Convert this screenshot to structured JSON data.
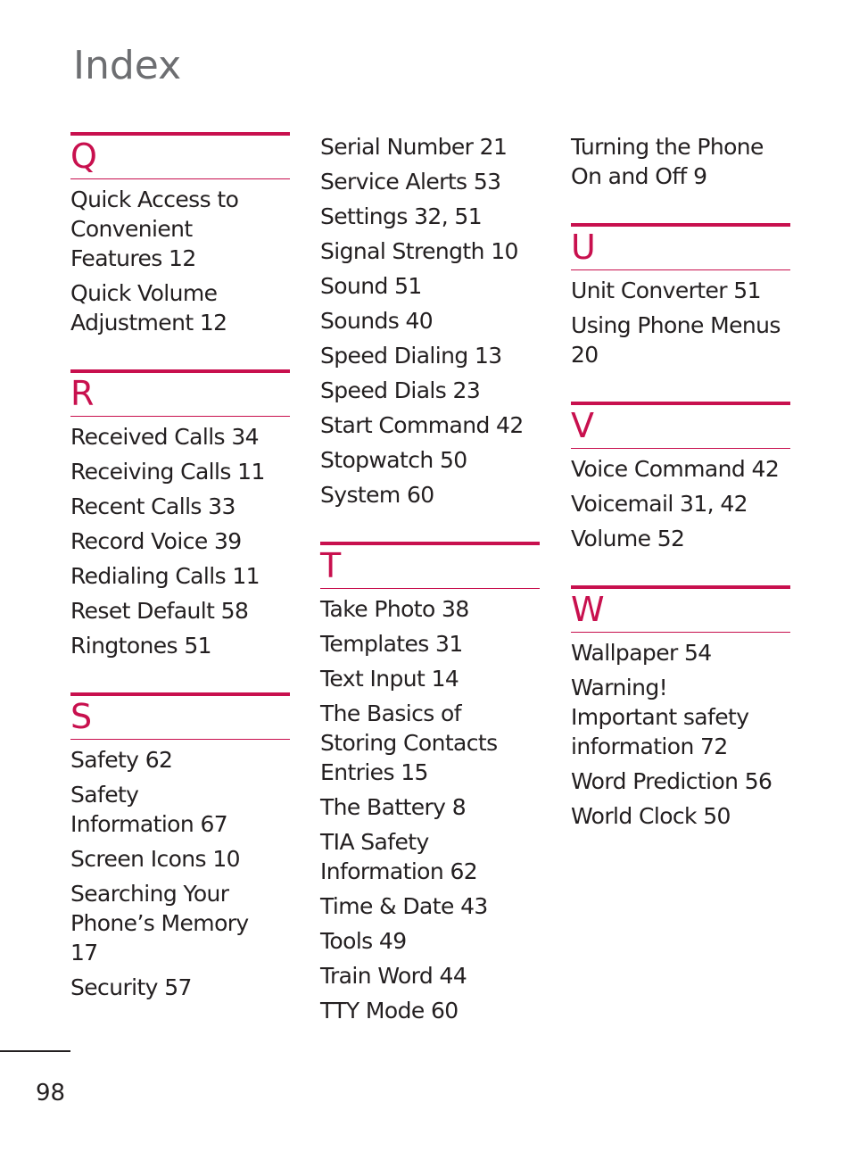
{
  "page": {
    "title": "Index",
    "page_number": "98",
    "accent_color": "#c8104e"
  },
  "columns": [
    {
      "sections": [
        {
          "letter": "Q",
          "entries": [
            "Quick Access to Convenient Features 12",
            "Quick Volume Adjustment 12"
          ]
        },
        {
          "letter": "R",
          "entries": [
            "Received Calls 34",
            "Receiving Calls 11",
            "Recent Calls 33",
            "Record Voice 39",
            "Redialing Calls 11",
            "Reset Default 58",
            "Ringtones 51"
          ]
        },
        {
          "letter": "S",
          "entries": [
            "Safety 62",
            "Safety Information 67",
            "Screen Icons 10",
            "Searching Your Phone’s Memory 17",
            "Security 57"
          ]
        }
      ]
    },
    {
      "continued_entries": [
        "Serial Number 21",
        "Service Alerts 53",
        "Settings 32, 51",
        "Signal Strength 10",
        "Sound 51",
        "Sounds 40",
        "Speed Dialing 13",
        "Speed Dials 23",
        "Start Command 42",
        "Stopwatch 50",
        "System 60"
      ],
      "sections": [
        {
          "letter": "T",
          "entries": [
            "Take Photo 38",
            "Templates 31",
            "Text Input 14",
            "The Basics of Storing Contacts Entries 15",
            "The Battery 8",
            "TIA Safety Information 62",
            "Time & Date 43",
            "Tools 49",
            "Train Word 44",
            "TTY Mode 60"
          ]
        }
      ]
    },
    {
      "continued_entries": [
        "Turning the Phone On and Off 9"
      ],
      "sections": [
        {
          "letter": "U",
          "entries": [
            "Unit Converter 51",
            "Using Phone Menus 20"
          ]
        },
        {
          "letter": "V",
          "entries": [
            "Voice Command 42",
            "Voicemail 31, 42",
            "Volume 52"
          ]
        },
        {
          "letter": "W",
          "entries": [
            "Wallpaper 54",
            "Warning! Important safety information 72",
            "Word Prediction 56",
            "World Clock 50"
          ]
        }
      ]
    }
  ]
}
